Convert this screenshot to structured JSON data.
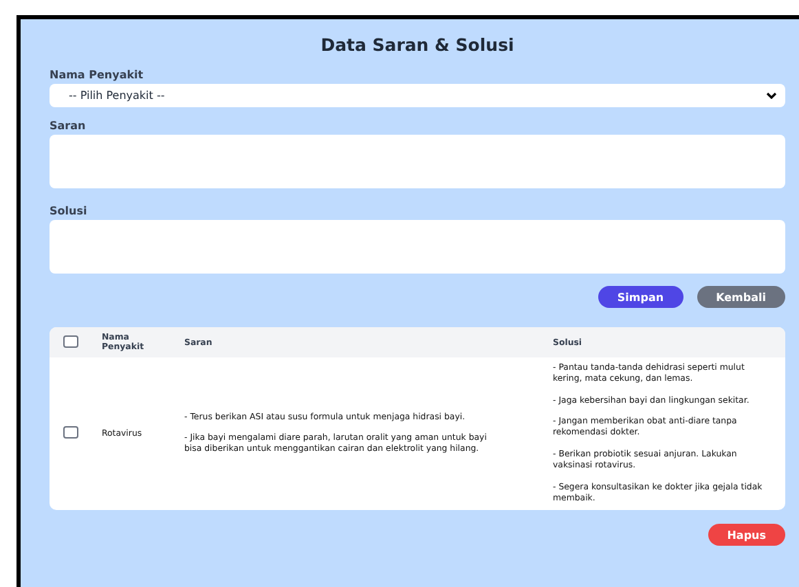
{
  "title": "Data Saran & Solusi",
  "form": {
    "disease_label": "Nama Penyakit",
    "disease_select": "-- Pilih Penyakit --",
    "saran_label": "Saran",
    "solusi_label": "Solusi"
  },
  "buttons": [
    {
      "label": "Simpan",
      "kind": "primary"
    },
    {
      "label": "Kembali",
      "kind": "secondary"
    }
  ],
  "table": {
    "select_all_checked": false,
    "columns": [
      "Nama Penyakit",
      "Saran",
      "Solusi"
    ],
    "rows": [
      {
        "checked": false,
        "name": "Rotavirus",
        "saran": [
          "- Terus berikan ASI atau susu formula untuk menjaga hidrasi bayi.",
          "- Jika bayi mengalami diare parah, larutan oralit yang aman untuk bayi bisa diberikan untuk menggantikan cairan dan elektrolit yang hilang."
        ],
        "solusi": [
          "- Pantau tanda-tanda dehidrasi seperti mulut kering, mata cekung, dan lemas.",
          "- Jaga kebersihan bayi dan lingkungan sekitar.",
          "- Jangan memberikan obat anti-diare tanpa rekomendasi dokter.",
          "- Berikan probiotik sesuai anjuran. Lakukan vaksinasi rotavirus.",
          "- Segera konsultasikan ke dokter jika gejala tidak membaik."
        ]
      }
    ]
  },
  "delete_button": "Hapus"
}
